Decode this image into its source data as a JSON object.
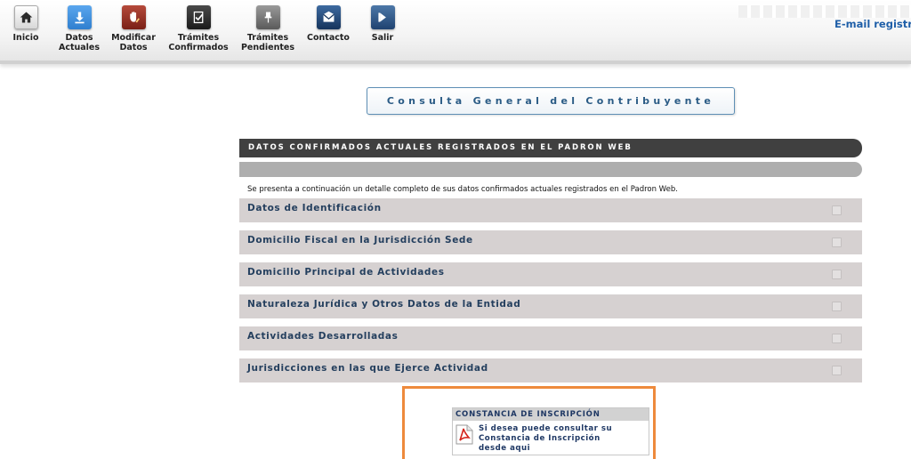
{
  "nav": {
    "items": [
      {
        "id": "inicio",
        "label": "Inicio",
        "icon": "home-icon",
        "color": "#e8e8e8"
      },
      {
        "id": "datos-actuales",
        "label": "Datos\nActuales",
        "icon": "download-icon",
        "color": "#2f7fcf"
      },
      {
        "id": "modificar-datos",
        "label": "Modificar\nDatos",
        "icon": "edit-hand-icon",
        "color": "#8a2a20"
      },
      {
        "id": "tramites-confirmados",
        "label": "Trámites\nConfirmados",
        "icon": "document-check-icon",
        "color": "#2b2b2b"
      },
      {
        "id": "tramites-pendientes",
        "label": "Trámites\nPendientes",
        "icon": "pin-icon",
        "color": "#6d6d6d"
      },
      {
        "id": "contacto",
        "label": "Contacto",
        "icon": "envelope-icon",
        "color": "#1f3f6b"
      },
      {
        "id": "salir",
        "label": "Salir",
        "icon": "exit-icon",
        "color": "#2a4f7a"
      }
    ],
    "email_link": "E-mail registrado"
  },
  "page_title": "Consulta General del Contribuyente",
  "section": {
    "header": "DATOS CONFIRMADOS ACTUALES REGISTRADOS EN EL PADRON WEB",
    "intro": "Se presenta a continuación un detalle completo de sus datos confirmados actuales registrados en el Padron Web.",
    "rows": [
      {
        "label": "Datos de Identificación"
      },
      {
        "label": "Domicilio Fiscal en la Jurisdicción Sede"
      },
      {
        "label": "Domicilio Principal de Actividades"
      },
      {
        "label": "Naturaleza Jurídica y Otros Datos de la Entidad"
      },
      {
        "label": "Actividades Desarrolladas"
      },
      {
        "label": "Jurisdicciones en las que Ejerce Actividad"
      }
    ]
  },
  "constancia": {
    "title": "CONSTANCIA DE INSCRIPCIÓN",
    "link_text": "Si desea puede consultar su\nConstancia de Inscripción\ndesde aqui",
    "icon": "pdf-icon"
  },
  "colors": {
    "highlight": "#ee8a3c",
    "header_bg": "#404040",
    "row_bg": "#d6d1d1",
    "link": "#1f5fa8"
  }
}
